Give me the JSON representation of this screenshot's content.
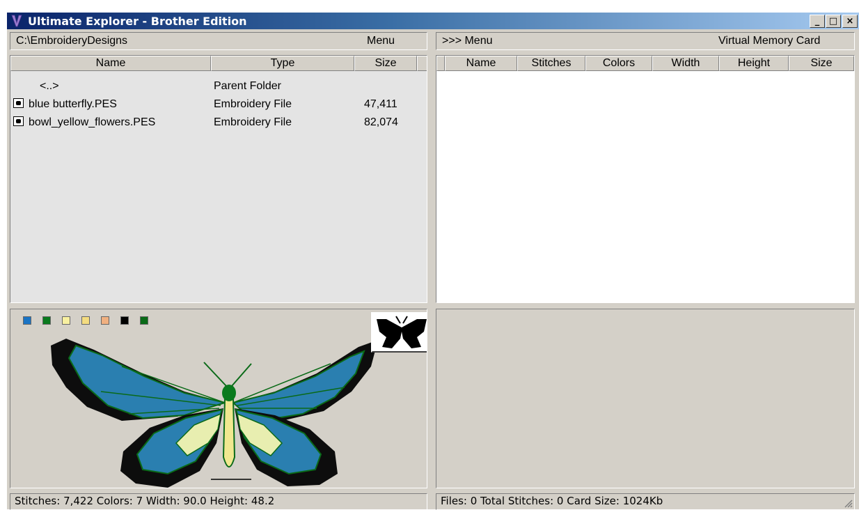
{
  "window": {
    "title": "Ultimate Explorer - Brother Edition",
    "controls": {
      "minimize": "_",
      "maximize": "□",
      "close": "×"
    }
  },
  "left": {
    "path": "C:\\EmbroideryDesigns",
    "menu_label": "Menu",
    "columns": [
      "Name",
      "Type",
      "Size"
    ],
    "rows": [
      {
        "name": "<..>",
        "type": "Parent Folder",
        "size": "",
        "icon": ""
      },
      {
        "name": "blue butterfly.PES",
        "type": "Embroidery File",
        "size": "47,411",
        "icon": "embroidery-file-icon"
      },
      {
        "name": "bowl_yellow_flowers.PES",
        "type": "Embroidery File",
        "size": "82,074",
        "icon": "embroidery-file-icon"
      }
    ],
    "swatches": [
      "#1a74c4",
      "#0a7a1e",
      "#f8f0a0",
      "#f4dc80",
      "#f0b080",
      "#000000",
      "#0a6a18"
    ],
    "status": "Stitches: 7,422   Colors: 7   Width: 90.0   Height: 48.2"
  },
  "right": {
    "menu_label": ">>> Menu",
    "device": "Virtual Memory Card",
    "columns": [
      "Name",
      "Stitches",
      "Colors",
      "Width",
      "Height",
      "Size"
    ],
    "status": "Files: 0   Total Stitches: 0   Card Size: 1024Kb"
  }
}
